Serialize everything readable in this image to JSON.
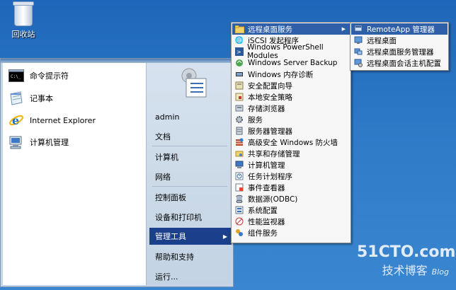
{
  "desktop": {
    "recycle_bin_label": "回收站"
  },
  "start_menu": {
    "pinned": [
      {
        "label": "命令提示符",
        "icon": "cmd-icon"
      },
      {
        "label": "记事本",
        "icon": "notepad-icon"
      },
      {
        "label": "Internet Explorer",
        "icon": "ie-icon"
      },
      {
        "label": "计算机管理",
        "icon": "computer-management-icon"
      }
    ],
    "right": {
      "user": "admin",
      "documents": "文档",
      "computer": "计算机",
      "network": "网络",
      "control_panel": "控制面板",
      "devices": "设备和打印机",
      "admin_tools": "管理工具",
      "help": "帮助和支持",
      "run": "运行..."
    }
  },
  "admin_tools_menu": {
    "items": [
      {
        "label": "远程桌面服务",
        "icon": "folder-icon",
        "has_submenu": true
      },
      {
        "label": "iSCSI 发起程序",
        "icon": "iscsi-icon"
      },
      {
        "label": "Windows PowerShell Modules",
        "icon": "powershell-icon"
      },
      {
        "label": "Windows Server Backup",
        "icon": "backup-icon"
      },
      {
        "label": "Windows 内存诊断",
        "icon": "memory-icon"
      },
      {
        "label": "安全配置向导",
        "icon": "security-wizard-icon"
      },
      {
        "label": "本地安全策略",
        "icon": "security-policy-icon"
      },
      {
        "label": "存储浏览器",
        "icon": "storage-explorer-icon"
      },
      {
        "label": "服务",
        "icon": "services-icon"
      },
      {
        "label": "服务器管理器",
        "icon": "server-manager-icon"
      },
      {
        "label": "高级安全 Windows 防火墙",
        "icon": "firewall-icon"
      },
      {
        "label": "共享和存储管理",
        "icon": "share-storage-icon"
      },
      {
        "label": "计算机管理",
        "icon": "computer-management-icon"
      },
      {
        "label": "任务计划程序",
        "icon": "task-scheduler-icon"
      },
      {
        "label": "事件查看器",
        "icon": "event-viewer-icon"
      },
      {
        "label": "数据源(ODBC)",
        "icon": "odbc-icon"
      },
      {
        "label": "系统配置",
        "icon": "system-config-icon"
      },
      {
        "label": "性能监视器",
        "icon": "performance-monitor-icon"
      },
      {
        "label": "组件服务",
        "icon": "component-services-icon"
      }
    ]
  },
  "rds_menu": {
    "items": [
      {
        "label": "RemoteApp 管理器",
        "icon": "remoteapp-icon"
      },
      {
        "label": "远程桌面",
        "icon": "remote-desktop-icon"
      },
      {
        "label": "远程桌面服务管理器",
        "icon": "rds-manager-icon"
      },
      {
        "label": "远程桌面会话主机配置",
        "icon": "rdsh-config-icon"
      }
    ]
  },
  "watermark": {
    "top": "51CTO.com",
    "bottom": "技术博客",
    "blog": "Blog"
  },
  "colors": {
    "selection": "#2f5fa8",
    "start_selection": "#1c3f8c"
  }
}
